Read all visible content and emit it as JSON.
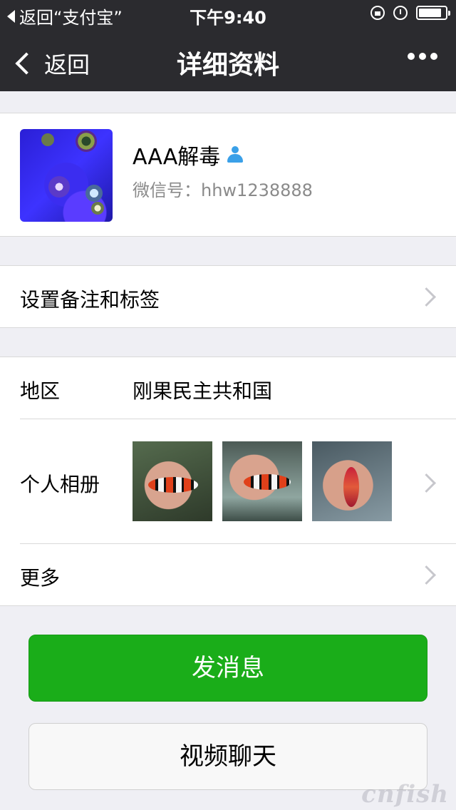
{
  "status_bar": {
    "back_app": "返回“支付宝”",
    "time": "下午9:40",
    "battery_level": 0.85
  },
  "nav": {
    "back_label": "返回",
    "title": "详细资料"
  },
  "profile": {
    "name": "AAA解毒",
    "wechat_id": "微信号：hhw1238888"
  },
  "remark_row": {
    "label": "设置备注和标签"
  },
  "region_row": {
    "label": "地区",
    "value": "刚果民主共和国"
  },
  "album_row": {
    "label": "个人相册"
  },
  "more_row": {
    "label": "更多"
  },
  "buttons": {
    "send_message": "发消息",
    "video_chat": "视频聊天"
  },
  "watermark": "cnfish"
}
